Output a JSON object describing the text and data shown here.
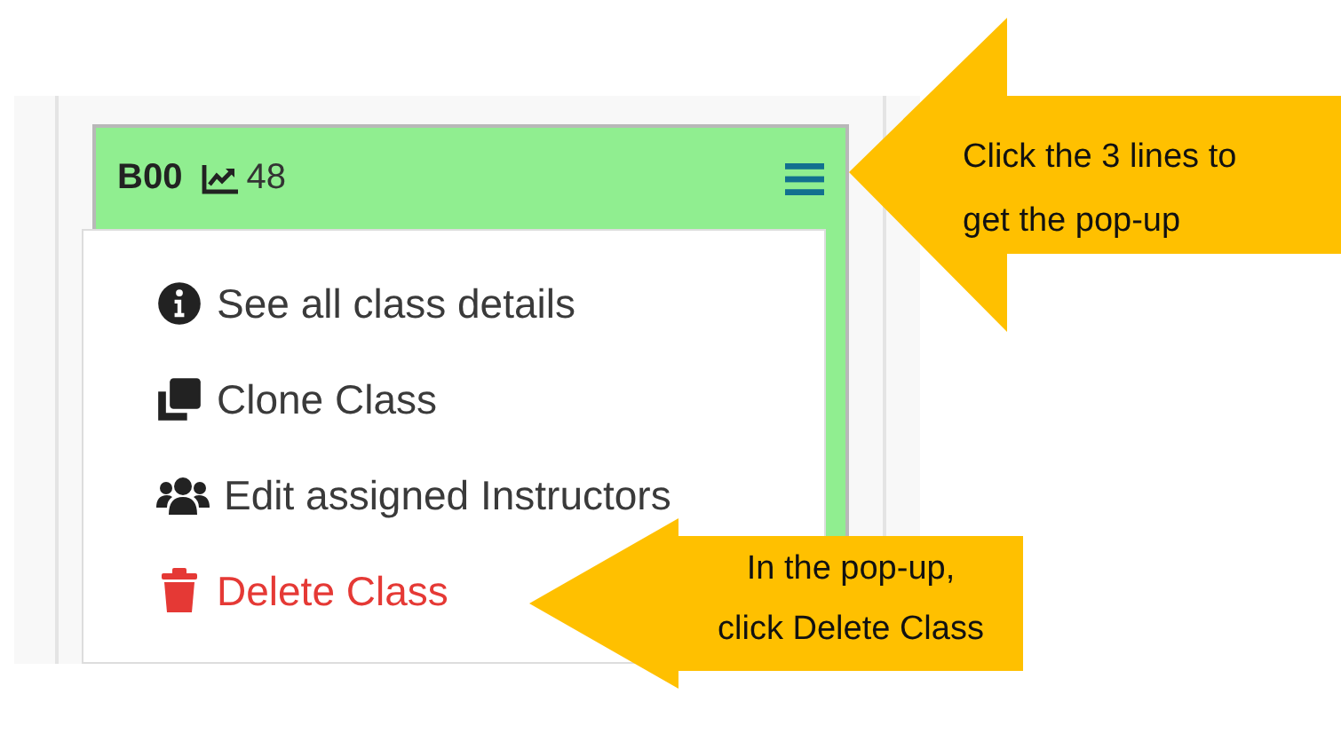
{
  "card": {
    "title": "B00",
    "count": "48"
  },
  "menu": [
    {
      "label": "See all class details",
      "kind": "info"
    },
    {
      "label": "Clone Class",
      "kind": "clone"
    },
    {
      "label": "Edit assigned Instructors",
      "kind": "users"
    },
    {
      "label": "Delete Class",
      "kind": "delete"
    }
  ],
  "callouts": [
    {
      "kind": "top",
      "lines": [
        "Click the 3 lines to",
        "get the pop-up"
      ]
    },
    {
      "kind": "bottom",
      "lines": [
        "In the pop-up,",
        "click Delete Class"
      ]
    }
  ]
}
